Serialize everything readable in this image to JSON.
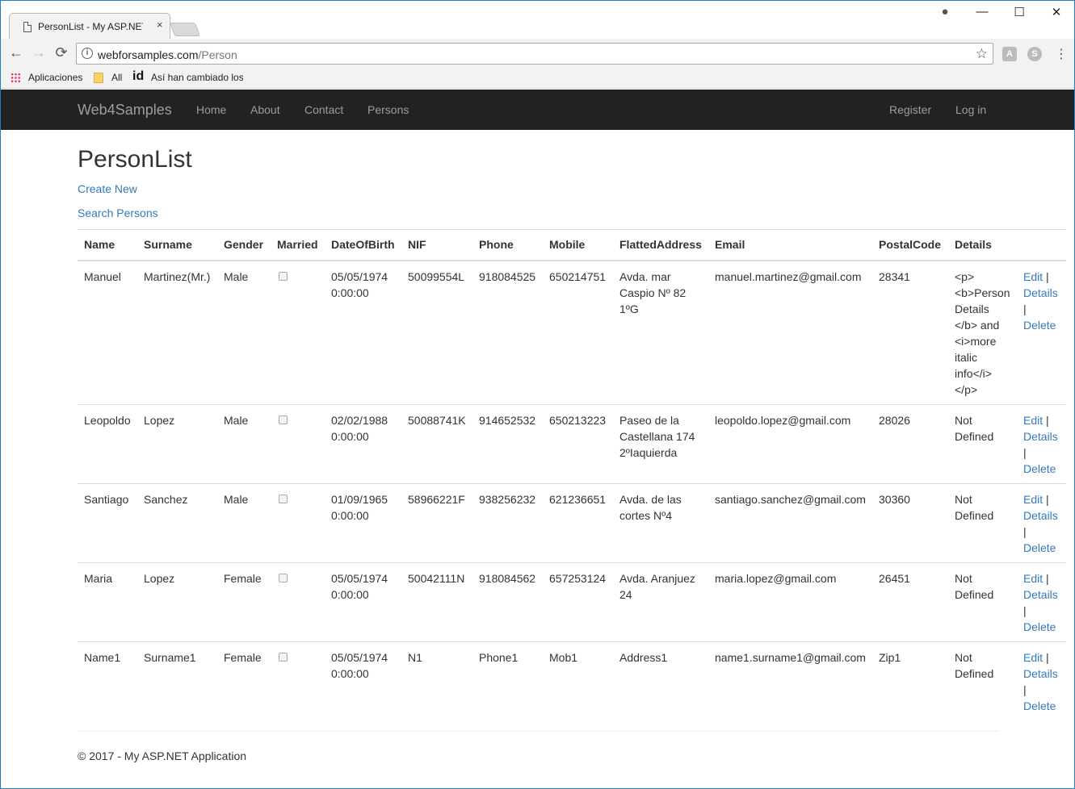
{
  "browser": {
    "tab_title": "PersonList - My ASP.NET",
    "tab_close": "×",
    "url_host": "webforsamples.com",
    "url_path": "/Person",
    "back": "←",
    "forward": "→",
    "reload": "⟳",
    "star": "☆",
    "menu": "⋮",
    "minimize": "—",
    "maximize": "☐",
    "close": "✕",
    "profile": "●",
    "bookmarks": {
      "apps": "Aplicaciones",
      "all": "All",
      "id_label": "id",
      "article": "Así han cambiado los"
    }
  },
  "navbar": {
    "brand": "Web4Samples",
    "links": [
      "Home",
      "About",
      "Contact",
      "Persons"
    ],
    "register": "Register",
    "login": "Log in"
  },
  "page": {
    "title": "PersonList",
    "create_new": "Create New",
    "search_persons": "Search Persons"
  },
  "table": {
    "headers": [
      "Name",
      "Surname",
      "Gender",
      "Married",
      "DateOfBirth",
      "NIF",
      "Phone",
      "Mobile",
      "FlattedAddress",
      "Email",
      "PostalCode",
      "Details"
    ],
    "rows": [
      {
        "name": "Manuel",
        "surname": "Martinez(Mr.)",
        "gender": "Male",
        "married": false,
        "dob_date": "05/05/1974",
        "dob_time": "0:00:00",
        "nif": "50099554L",
        "phone": "918084525",
        "mobile": "650214751",
        "address": "Avda. mar Caspio Nº 82 1ºG",
        "email": "manuel.martinez@gmail.com",
        "postal": "28341",
        "details": "<p> <b>Person Details </b> and <i>more italic info</i> </p>"
      },
      {
        "name": "Leopoldo",
        "surname": "Lopez",
        "gender": "Male",
        "married": false,
        "dob_date": "02/02/1988",
        "dob_time": "0:00:00",
        "nif": "50088741K",
        "phone": "914652532",
        "mobile": "650213223",
        "address": "Paseo de la Castellana 174 2ºIaquierda",
        "email": "leopoldo.lopez@gmail.com",
        "postal": "28026",
        "details": "Not Defined"
      },
      {
        "name": "Santiago",
        "surname": "Sanchez",
        "gender": "Male",
        "married": false,
        "dob_date": "01/09/1965",
        "dob_time": "0:00:00",
        "nif": "58966221F",
        "phone": "938256232",
        "mobile": "621236651",
        "address": "Avda. de las cortes Nº4",
        "email": "santiago.sanchez@gmail.com",
        "postal": "30360",
        "details": "Not Defined"
      },
      {
        "name": "Maria",
        "surname": "Lopez",
        "gender": "Female",
        "married": false,
        "dob_date": "05/05/1974",
        "dob_time": "0:00:00",
        "nif": "50042111N",
        "phone": "918084562",
        "mobile": "657253124",
        "address": "Avda. Aranjuez 24",
        "email": "maria.lopez@gmail.com",
        "postal": "26451",
        "details": "Not Defined"
      },
      {
        "name": "Name1",
        "surname": "Surname1",
        "gender": "Female",
        "married": false,
        "dob_date": "05/05/1974",
        "dob_time": "0:00:00",
        "nif": "N1",
        "phone": "Phone1",
        "mobile": "Mob1",
        "address": "Address1",
        "email": "name1.surname1@gmail.com",
        "postal": "Zip1",
        "details": "Not Defined"
      }
    ],
    "actions": {
      "edit": "Edit",
      "details": "Details",
      "delete": "Delete",
      "sep": "|"
    }
  },
  "footer": {
    "text": "© 2017 - My ASP.NET Application"
  }
}
